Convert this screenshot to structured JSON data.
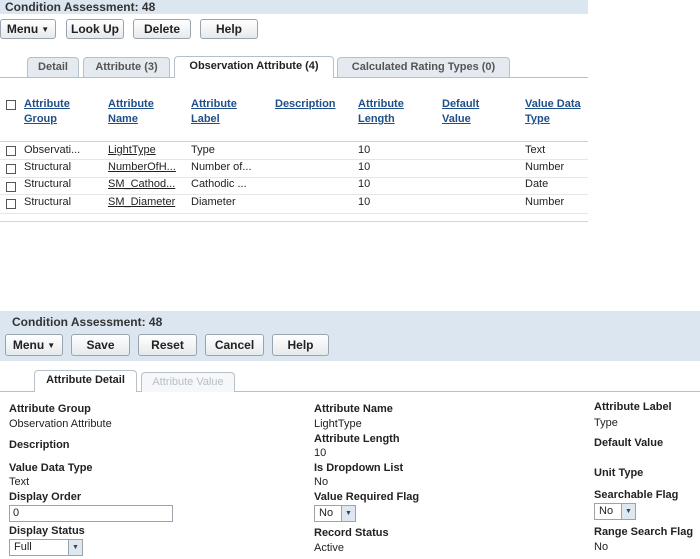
{
  "top": {
    "title": "Condition Assessment: 48",
    "buttons": {
      "menu": "Menu",
      "lookup": "Look Up",
      "delete": "Delete",
      "help": "Help"
    },
    "tabs": [
      "Detail",
      "Attribute (3)",
      "Observation Attribute (4)",
      "Calculated Rating Types (0)"
    ],
    "columns": [
      [
        "Attribute",
        "Group"
      ],
      [
        "Attribute",
        "Name"
      ],
      [
        "Attribute",
        "Label"
      ],
      [
        "Description",
        ""
      ],
      [
        "Attribute",
        "Length"
      ],
      [
        "Default",
        "Value"
      ],
      [
        "Value Data",
        "Type"
      ]
    ],
    "rows": [
      {
        "group": "Observati...",
        "name": "LightType",
        "label": "Type",
        "description": "",
        "length": "10",
        "default": "",
        "type": "Text"
      },
      {
        "group": "Structural",
        "name": "NumberOfH...",
        "label": "Number of...",
        "description": "",
        "length": "10",
        "default": "",
        "type": "Number"
      },
      {
        "group": "Structural",
        "name": "SM_Cathod...",
        "label": "Cathodic ...",
        "description": "",
        "length": "10",
        "default": "",
        "type": "Date"
      },
      {
        "group": "Structural",
        "name": "SM_Diameter",
        "label": "Diameter",
        "description": "",
        "length": "10",
        "default": "",
        "type": "Number"
      }
    ]
  },
  "bottom": {
    "title": "Condition Assessment: 48",
    "buttons": {
      "menu": "Menu",
      "save": "Save",
      "reset": "Reset",
      "cancel": "Cancel",
      "help": "Help"
    },
    "tabs": [
      "Attribute Detail",
      "Attribute Value"
    ],
    "fields": {
      "attribute_group": {
        "label": "Attribute Group",
        "value": "Observation Attribute"
      },
      "description": {
        "label": "Description",
        "value": ""
      },
      "value_data_type": {
        "label": "Value Data Type",
        "value": "Text"
      },
      "display_order": {
        "label": "Display Order",
        "value": "0"
      },
      "display_status": {
        "label": "Display Status",
        "value": "Full"
      },
      "attribute_name": {
        "label": "Attribute Name",
        "value": "LightType"
      },
      "attribute_length": {
        "label": "Attribute Length",
        "value": "10"
      },
      "is_dropdown": {
        "label": "Is Dropdown List",
        "value": "No"
      },
      "value_required": {
        "label": "Value Required Flag",
        "value": "No"
      },
      "record_status": {
        "label": "Record Status",
        "value": "Active"
      },
      "attribute_label": {
        "label": "Attribute Label",
        "value": "Type"
      },
      "default_value": {
        "label": "Default Value",
        "value": ""
      },
      "unit_type": {
        "label": "Unit Type",
        "value": ""
      },
      "searchable": {
        "label": "Searchable Flag",
        "value": "No"
      },
      "range_search": {
        "label": "Range Search Flag",
        "value": "No"
      }
    }
  },
  "icons": {
    "dropdown": "triangle-down-icon"
  }
}
